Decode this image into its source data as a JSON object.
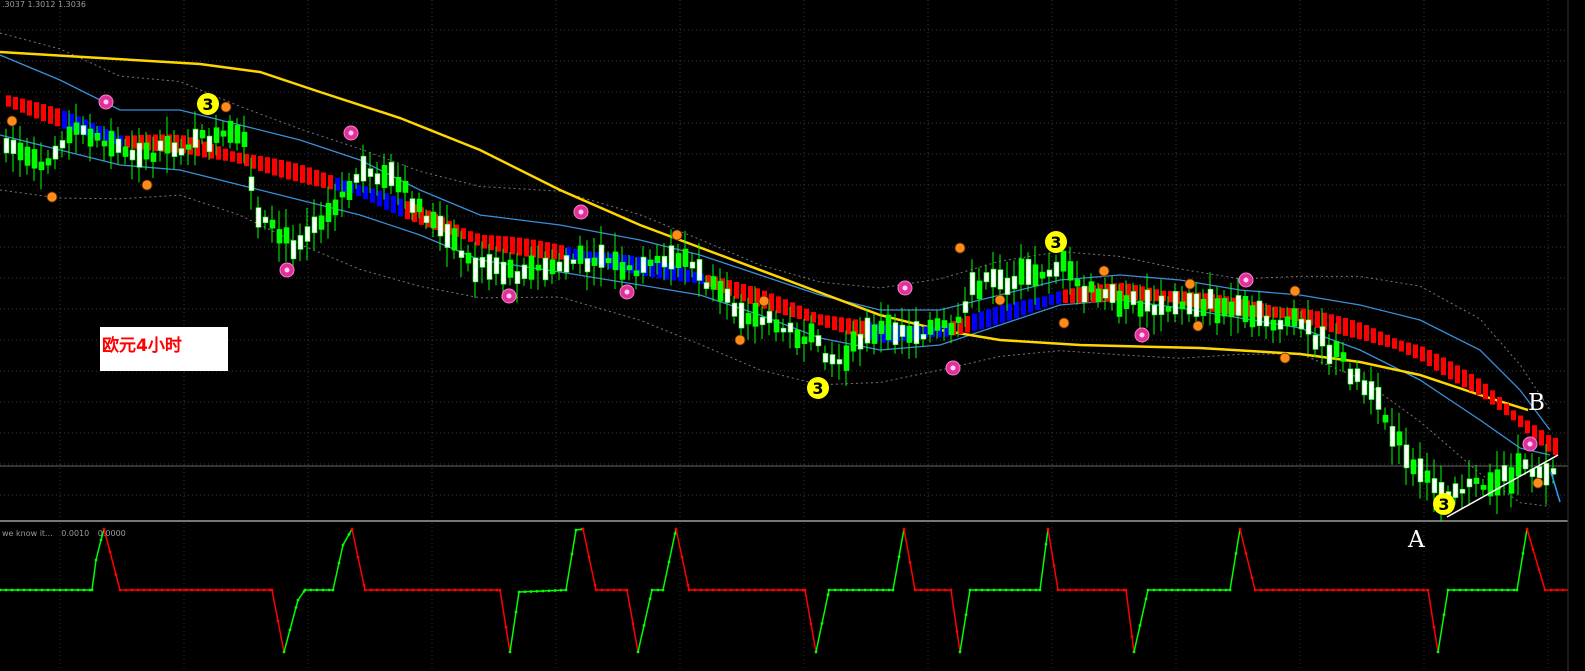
{
  "chart": {
    "ohlc_label": ".3037 1.3012 1.3036",
    "indicator_label": "we know it...",
    "indicator_values": [
      "0.0010",
      "0.0000"
    ],
    "note": "欧元4小时",
    "point_a": "A",
    "point_b": "B",
    "wave_badge": "3"
  },
  "colors": {
    "background": "#000000",
    "bull_candle": "#00ff00",
    "bear_candle": "#ffffff",
    "ma_slow": "#ffd700",
    "envelope": "#3a8fd8",
    "heiken_bear": "#ff0000",
    "heiken_bull": "#0000ff",
    "oscillator_up": "#00ff00",
    "oscillator_down": "#ff0000",
    "fractal_badge": "#ff8c1a",
    "wave_badge": "#ffff00",
    "flower_marker": "#e0309a"
  },
  "icons": [
    "wave-3-badge",
    "fractal-badge",
    "flower-marker"
  ]
}
